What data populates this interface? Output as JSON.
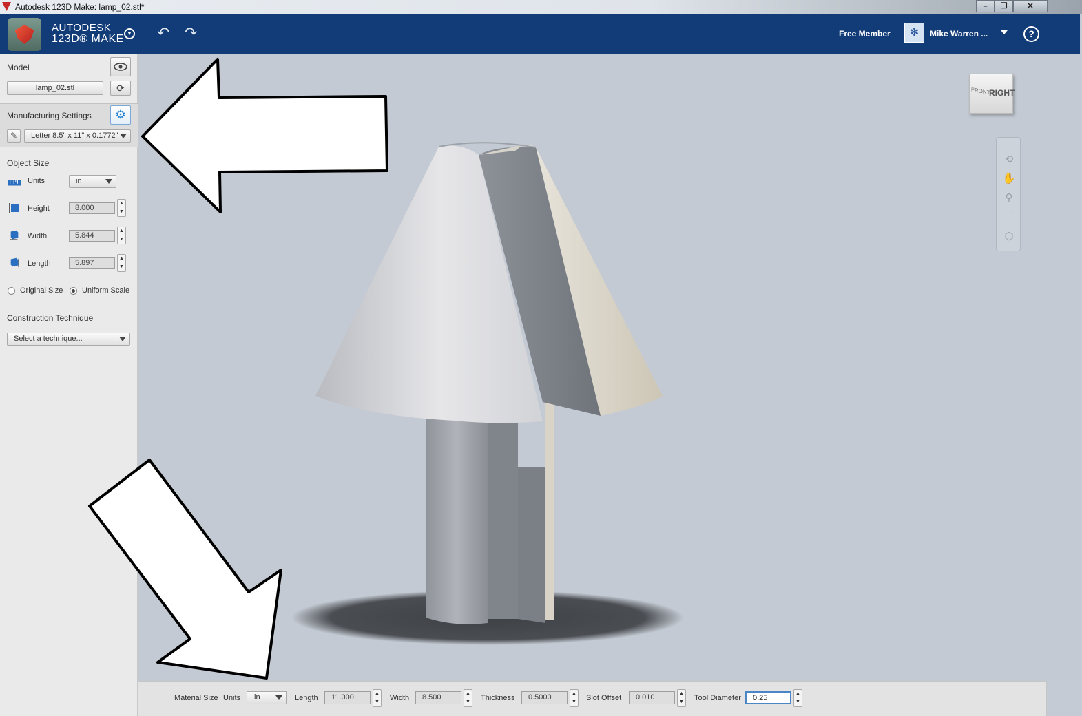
{
  "window": {
    "title": "Autodesk 123D Make: lamp_02.stl*",
    "minimize": "–",
    "maximize": "❐",
    "close": "✕"
  },
  "header": {
    "brand_line1": "AUTODESK",
    "brand_line2": "123D® MAKE",
    "membership": "Free Member",
    "user_name": "Mike Warren ...",
    "help": "?"
  },
  "model": {
    "title": "Model",
    "file_name": "lamp_02.stl"
  },
  "manufacturing": {
    "title": "Manufacturing Settings",
    "sheet_preset": "Letter 8.5\" x 11\" x 0.1772\""
  },
  "object_size": {
    "title": "Object Size",
    "units_label": "Units",
    "units_value": "in",
    "height_label": "Height",
    "height_value": "8.000",
    "width_label": "Width",
    "width_value": "5.844",
    "length_label": "Length",
    "length_value": "5.897",
    "original_size_label": "Original Size",
    "uniform_scale_label": "Uniform Scale",
    "selected_scale": "Uniform Scale"
  },
  "construction": {
    "title": "Construction Technique",
    "placeholder": "Select a technique..."
  },
  "viewcube": {
    "front_label": "FRONT",
    "right_label": "RIGHT"
  },
  "nav_tools": [
    "orbit-icon",
    "pan-icon",
    "zoom-icon",
    "fit-icon",
    "view-cube-icon"
  ],
  "material_bar": {
    "material_size_label": "Material Size",
    "units_label": "Units",
    "units_value": "in",
    "length_label": "Length",
    "length_value": "11.000",
    "width_label": "Width",
    "width_value": "8.500",
    "thickness_label": "Thickness",
    "thickness_value": "0.5000",
    "slot_offset_label": "Slot Offset",
    "slot_offset_value": "0.010",
    "tool_diameter_label": "Tool Diameter",
    "tool_diameter_value": "0.25"
  },
  "colors": {
    "header_bg": "#123c78",
    "panel_bg": "#eaeaea",
    "viewport_bg": "#c4cad3",
    "accent": "#1b7fd1"
  }
}
